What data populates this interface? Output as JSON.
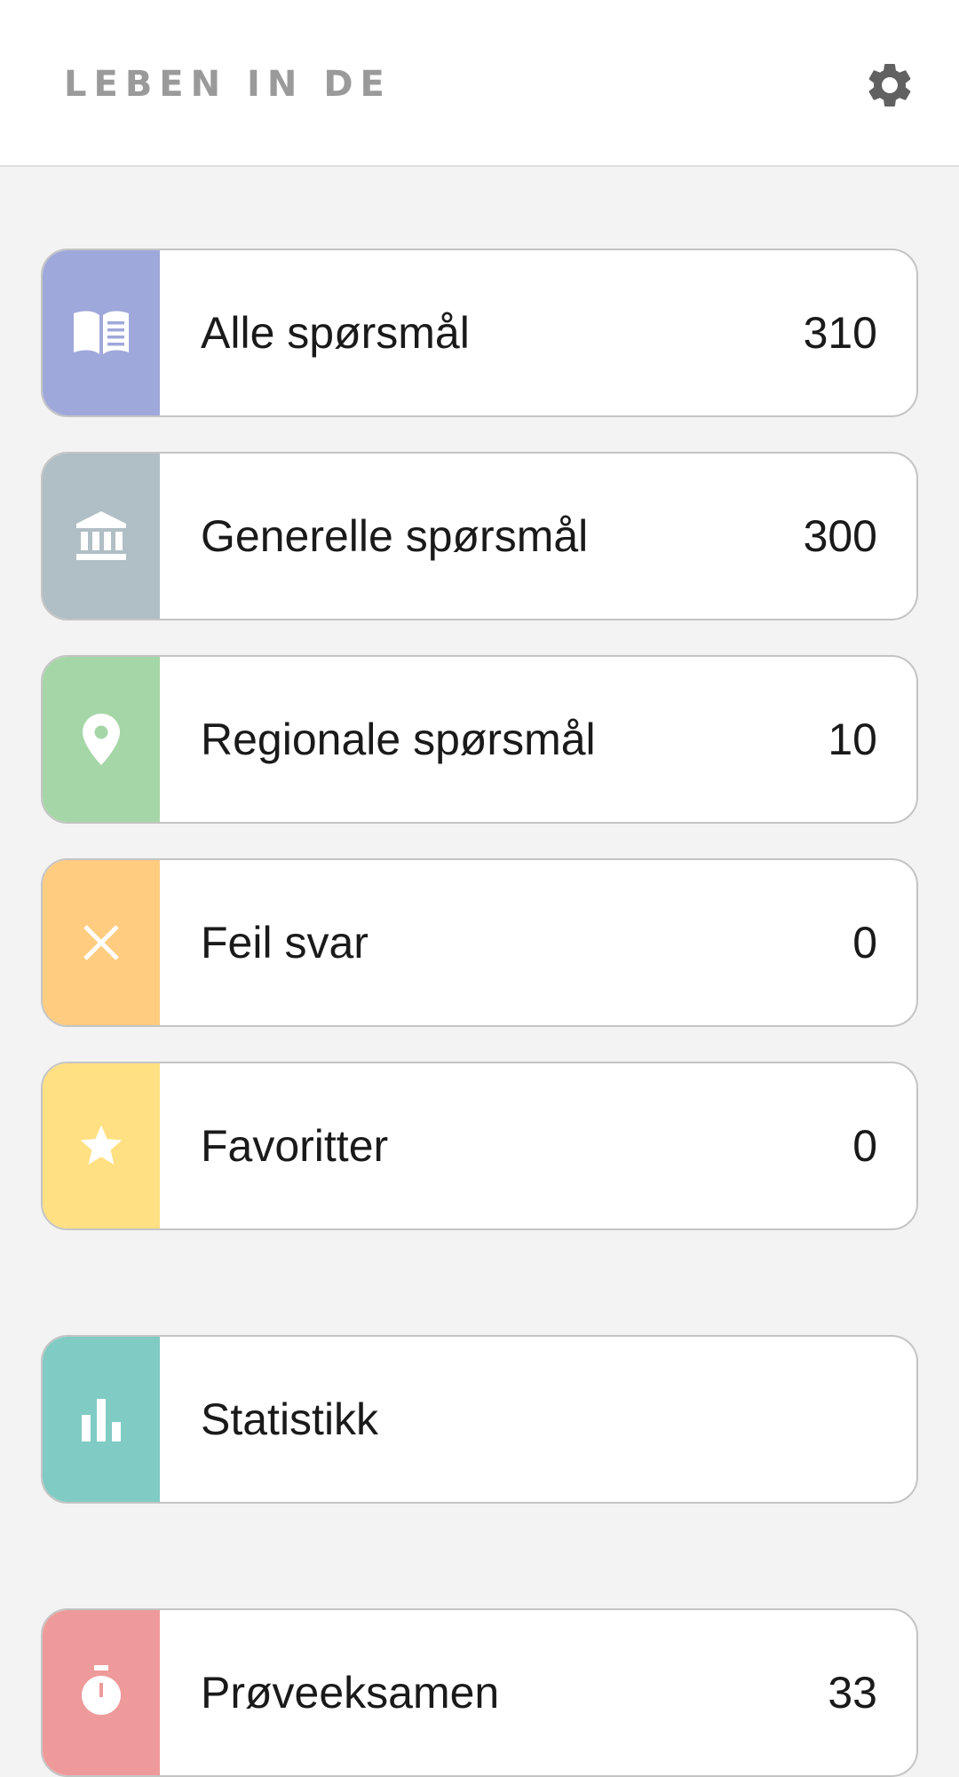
{
  "header": {
    "title": "LEBEN IN DE",
    "settings_icon": "gear-icon"
  },
  "menu": [
    {
      "label": "Alle spørsmål",
      "count": "310",
      "icon": "book-icon",
      "color": "#9fa8da"
    },
    {
      "label": "Generelle spørsmål",
      "count": "300",
      "icon": "institution-icon",
      "color": "#b0bec5"
    },
    {
      "label": "Regionale spørsmål",
      "count": "10",
      "icon": "location-pin-icon",
      "color": "#a5d6a7"
    },
    {
      "label": "Feil svar",
      "count": "0",
      "icon": "close-icon",
      "color": "#ffcc80"
    },
    {
      "label": "Favoritter",
      "count": "0",
      "icon": "star-icon",
      "color": "#ffe082"
    }
  ],
  "statistics": {
    "label": "Statistikk",
    "icon": "bar-chart-icon",
    "color": "#80cbc4"
  },
  "exam": {
    "label": "Prøveeksamen",
    "count": "33",
    "icon": "stopwatch-icon",
    "color": "#ef9a9a"
  }
}
